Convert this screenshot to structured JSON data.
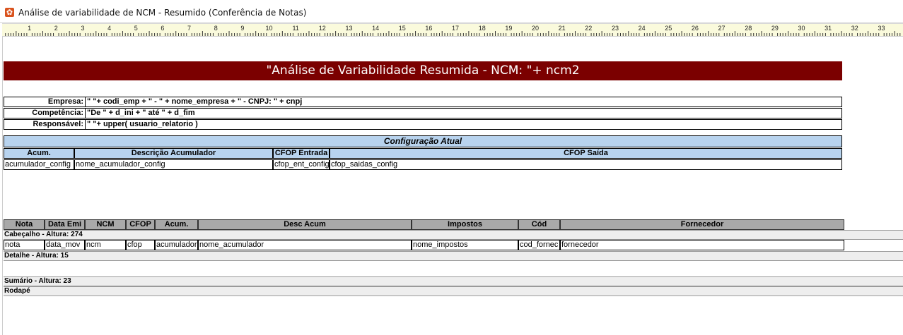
{
  "window": {
    "title": "Análise de variabilidade de NCM - Resumido (Conferência de Notas)",
    "icon": "gear-icon"
  },
  "ruler": {
    "numbers": [
      "1",
      "2",
      "3",
      "4",
      "5",
      "6",
      "7",
      "8",
      "9",
      "10",
      "11",
      "12",
      "13",
      "14",
      "15",
      "16",
      "17",
      "18",
      "19",
      "20",
      "21",
      "22",
      "23",
      "24",
      "25",
      "26",
      "27",
      "28",
      "29",
      "30",
      "31",
      "32",
      "33"
    ]
  },
  "report": {
    "title": "\"Análise de Variabilidade Resumida - NCM: \"+ ncm2",
    "title_bg": "#7b0000",
    "info": [
      {
        "label": "Empresa:",
        "value": "\" \"+ codi_emp  + \" - \" +   nome_empresa + \" - CNPJ: \" +   cnpj"
      },
      {
        "label": "Competência:",
        "value": "\"De \" +  d_ini  + \" até \" +  d_fim"
      },
      {
        "label": "Responsável:",
        "value": "\" \"+ upper(  usuario_relatorio )"
      }
    ],
    "config": {
      "title": "Configuração Atual",
      "headers": [
        "Acum.",
        "Descrição Acumulador",
        "CFOP Entrada",
        "CFOP Saída"
      ],
      "values": [
        "acumulador_config",
        "nome_acumulador_config",
        "cfop_ent_config",
        "cfop_saidas_config"
      ],
      "header_bg": "#b8d3ee"
    },
    "columns": {
      "headers": [
        "Nota",
        "Data Emi",
        "NCM",
        "CFOP",
        "Acum.",
        "Desc Acum",
        "Impostos",
        "Cód",
        "Fornecedor"
      ],
      "values": [
        "nota",
        "data_mov",
        "ncm",
        "cfop",
        "acumulador",
        "nome_acumulador",
        "nome_impostos",
        "cod_fornec",
        "fornecedor"
      ]
    },
    "bands": {
      "header": "Cabeçalho - Altura: 274",
      "detail": "Detalhe - Altura: 15",
      "summary": "Sumário - Altura: 23",
      "footer": "Rodapé"
    }
  }
}
